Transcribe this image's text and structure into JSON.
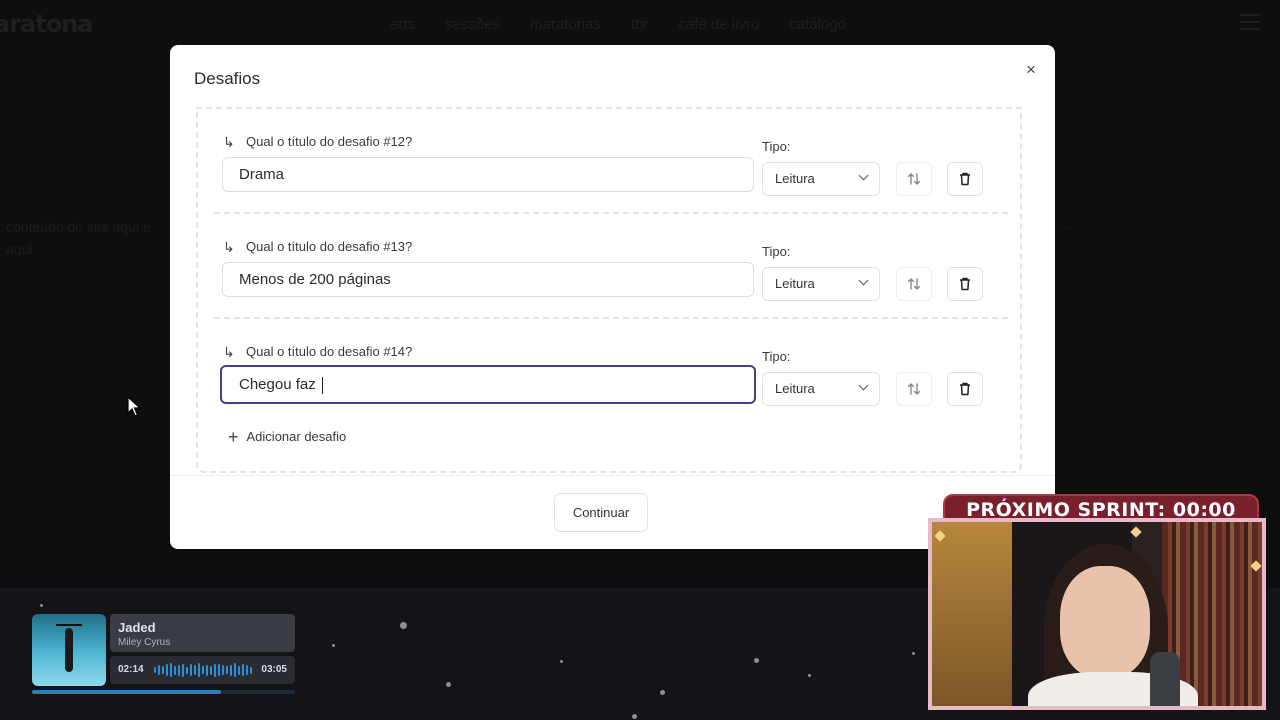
{
  "background": {
    "logo": "aratona",
    "nav": [
      "arts",
      "sessões",
      "maratonas",
      "tbr",
      "café de livro",
      "catálogo"
    ],
    "text_left": "conteúdo do site aqui e aqui",
    "text_right": "..."
  },
  "modal": {
    "title": "Desafios",
    "close_label": "×",
    "type_label": "Tipo:",
    "challenges": [
      {
        "question": "Qual o título do desafio #12?",
        "value": "Drama",
        "type": "Leitura",
        "active": false
      },
      {
        "question": "Qual o título do desafio #13?",
        "value": "Menos de 200 páginas",
        "type": "Leitura",
        "active": false
      },
      {
        "question": "Qual o título do desafio #14?",
        "value": "Chegou faz ",
        "type": "Leitura",
        "active": true
      }
    ],
    "add_label": "Adicionar desafio",
    "continue_label": "Continuar",
    "accent_color": "#4a3d8f"
  },
  "player": {
    "title": "Jaded",
    "artist": "Miley Cyrus",
    "current": "02:14",
    "duration": "03:05",
    "progress": 0.72
  },
  "overlay": {
    "sprint": "PRÓXIMO SPRINT: 00:00"
  }
}
